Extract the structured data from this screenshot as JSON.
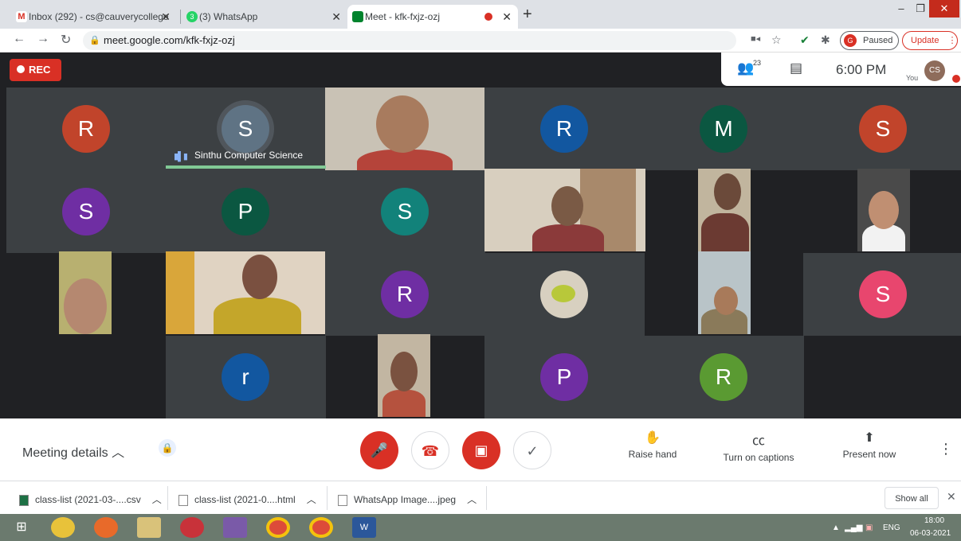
{
  "browser": {
    "tabs": [
      {
        "title": "Inbox (292) - cs@cauverycollege",
        "icon": "gmail-icon",
        "color": "#d93025"
      },
      {
        "title": "(3) WhatsApp",
        "icon": "whatsapp-icon",
        "color": "#25d366"
      },
      {
        "title": "Meet - kfk-fxjz-ozj",
        "icon": "meet-icon",
        "color": "#00832d"
      }
    ],
    "new_tab": "+",
    "url": "meet.google.com/kfk-fxjz-ozj",
    "profile_initial": "G",
    "paused_label": "Paused",
    "update_label": "Update"
  },
  "meet": {
    "rec_label": "REC",
    "participants_count": "23",
    "time": "6:00 PM",
    "you_label": "You",
    "self_initials": "CS",
    "speaker_name": "Sinthu Computer Science",
    "tiles": [
      {
        "initial": "R",
        "color": "#c1442b"
      },
      {
        "initial": "S",
        "color": "#5f7384"
      },
      {
        "initial": "R",
        "color": "#1257a0"
      },
      {
        "initial": "M",
        "color": "#0b5741"
      },
      {
        "initial": "S",
        "color": "#c1442b"
      },
      {
        "initial": "S",
        "color": "#6f2ea3"
      },
      {
        "initial": "P",
        "color": "#0b5741"
      },
      {
        "initial": "S",
        "color": "#12827a"
      },
      {
        "initial": "R",
        "color": "#6f2ea3"
      },
      {
        "initial": "S",
        "color": "#e8466e"
      },
      {
        "initial": "r",
        "color": "#1257a0"
      },
      {
        "initial": "P",
        "color": "#6f2ea3"
      },
      {
        "initial": "R",
        "color": "#5a9a32"
      }
    ]
  },
  "controls": {
    "meeting_details": "Meeting details",
    "raise_hand": "Raise hand",
    "captions": "Turn on captions",
    "present": "Present now"
  },
  "downloads": {
    "items": [
      "class-list (2021-03-....csv",
      "class-list (2021-0....html",
      "WhatsApp Image....jpeg"
    ],
    "show_all": "Show all"
  },
  "taskbar": {
    "language": "ENG",
    "time": "18:00",
    "date": "06-03-2021"
  }
}
